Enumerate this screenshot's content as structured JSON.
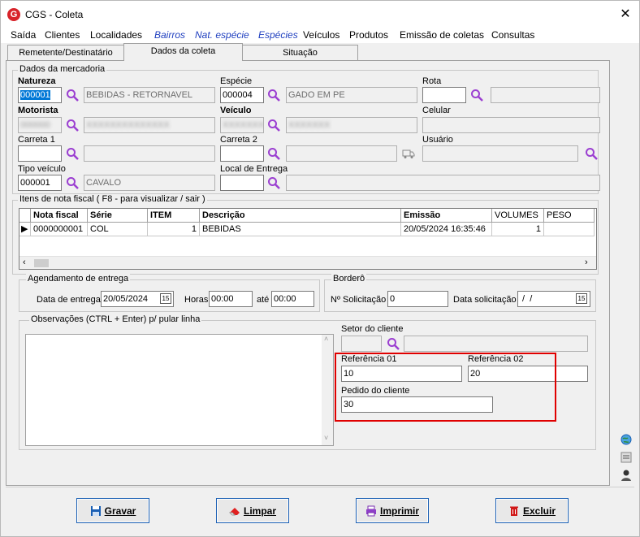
{
  "window": {
    "title": "CGS - Coleta",
    "app_icon": "G",
    "close": "✕"
  },
  "menu": [
    {
      "label": "Saída",
      "italic": false
    },
    {
      "label": "Clientes",
      "italic": false
    },
    {
      "label": "Localidades",
      "italic": false
    },
    {
      "label": "Bairros",
      "italic": true
    },
    {
      "label": "Nat. espécie",
      "italic": true
    },
    {
      "label": "Espécies",
      "italic": true
    },
    {
      "label": "Veículos",
      "italic": false
    },
    {
      "label": "Produtos",
      "italic": false
    },
    {
      "label": "Emissão de coletas",
      "italic": false
    },
    {
      "label": "Consultas",
      "italic": false
    }
  ],
  "tabs": [
    "Remetente/Destinatário",
    "Dados da coleta",
    "Situação"
  ],
  "mercadoria": {
    "group_title": "Dados da mercadoria",
    "natureza_label": "Natureza",
    "natureza_code": "000001",
    "natureza_desc": "BEBIDAS - RETORNAVEL",
    "especie_label": "Espécie",
    "especie_code": "000004",
    "especie_desc": "GADO EM PE",
    "rota_label": "Rota",
    "rota_code": "",
    "rota_desc": "",
    "motorista_label": "Motorista",
    "motorista_code": "000000",
    "motorista_desc": "XXXXXXXXXXXXXX",
    "veiculo_label": "Veículo",
    "veiculo_code": "XXXXXXX",
    "veiculo_desc": "XXXXXXX",
    "celular_label": "Celular",
    "celular_value": "",
    "carreta1_label": "Carreta 1",
    "carreta2_label": "Carreta 2",
    "usuario_label": "Usuário",
    "usuario_value": "",
    "tipo_veiculo_label": "Tipo veículo",
    "tipo_veiculo_code": "000001",
    "tipo_veiculo_desc": "CAVALO",
    "local_entrega_label": "Local de Entrega"
  },
  "itens": {
    "group_title": "Itens de nota fiscal ( F8 - para visualizar / sair )",
    "headers": [
      "Nota fiscal",
      "Série",
      "ITEM",
      "Descrição",
      "Emissão",
      "VOLUMES",
      "PESO"
    ],
    "rows": [
      {
        "marker": "▶",
        "nota": "0000000001",
        "serie": "COL",
        "item": "1",
        "descricao": "BEBIDAS",
        "emissao": "20/05/2024 16:35:46",
        "volumes": "1",
        "peso": ""
      }
    ]
  },
  "agendamento": {
    "group_title": "Agendamento de entrega",
    "data_label": "Data de entrega",
    "data_value": "20/05/2024",
    "horas_label": "Horas",
    "horas_value": "00:00",
    "ate_label": "até",
    "ate_value": "00:00"
  },
  "bordero": {
    "group_title": "Borderô",
    "solicitacao_label": "Nº Solicitação",
    "solicitacao_value": "0",
    "data_label": "Data solicitação",
    "data_value": " /  /"
  },
  "observacoes": {
    "group_title": "Observações (CTRL + Enter) p/ pular linha",
    "text": "",
    "setor_label": "Setor do cliente",
    "ref1_label": "Referência 01",
    "ref1_value": "10",
    "ref2_label": "Referência 02",
    "ref2_value": "20",
    "pedido_label": "Pedido do cliente",
    "pedido_value": "30"
  },
  "calendar_glyph": "15",
  "buttons": {
    "gravar": "Gravar",
    "limpar": "Limpar",
    "imprimir": "Imprimir",
    "excluir": "Excluir"
  },
  "side_icons": [
    "globe-icon",
    "document-icon",
    "user-icon"
  ],
  "colors": {
    "accent": "#1a5fb4",
    "highlight": "#e00000",
    "search_icon": "#9b3fd1"
  }
}
